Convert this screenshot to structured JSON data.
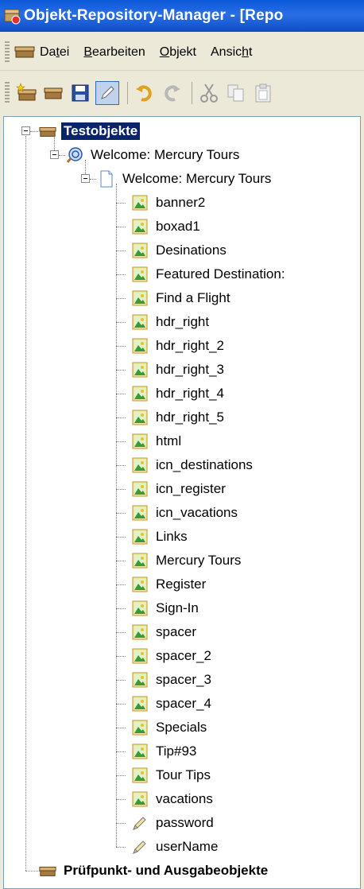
{
  "window": {
    "title": "Objekt-Repository-Manager - [Repo"
  },
  "menu": [
    {
      "pre": "Da",
      "u": "t",
      "post": "ei"
    },
    {
      "pre": "",
      "u": "B",
      "post": "earbeiten"
    },
    {
      "pre": "",
      "u": "O",
      "post": "bjekt"
    },
    {
      "pre": "Ansic",
      "u": "h",
      "post": "t"
    }
  ],
  "toolbar": [
    "new-object-icon",
    "object-icon",
    "save-icon",
    "edit-icon",
    "undo-icon",
    "redo-icon",
    "cut-icon",
    "copy-icon",
    "paste-icon"
  ],
  "tree": {
    "root": "Testobjekte",
    "browser": "Welcome: Mercury Tours",
    "page": "Welcome: Mercury Tours",
    "images": [
      "banner2",
      "boxad1",
      "Desinations",
      "Featured Destination:",
      "Find a Flight",
      "hdr_right",
      "hdr_right_2",
      "hdr_right_3",
      "hdr_right_4",
      "hdr_right_5",
      "html",
      "icn_destinations",
      "icn_register",
      "icn_vacations",
      "Links",
      "Mercury Tours",
      "Register",
      "Sign-In",
      "spacer",
      "spacer_2",
      "spacer_3",
      "spacer_4",
      "Specials",
      "Tip#93",
      "Tour Tips",
      "vacations"
    ],
    "edits": [
      "password",
      "userName"
    ],
    "checkpoints": "Prüfpunkt- und Ausgabeobjekte"
  }
}
